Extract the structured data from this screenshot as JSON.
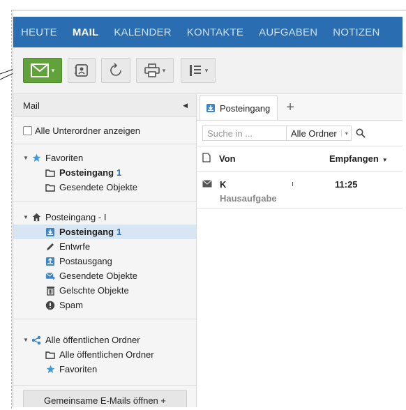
{
  "nav": {
    "items": [
      {
        "label": "HEUTE",
        "active": false
      },
      {
        "label": "MAIL",
        "active": true
      },
      {
        "label": "KALENDER",
        "active": false
      },
      {
        "label": "KONTAKTE",
        "active": false
      },
      {
        "label": "AUFGABEN",
        "active": false
      },
      {
        "label": "NOTIZEN",
        "active": false
      }
    ]
  },
  "toolbar": {
    "icons": [
      "envelope-icon",
      "address-book-icon",
      "refresh-icon",
      "printer-icon",
      "view-layout-icon"
    ],
    "accent": "#61a33a"
  },
  "sidebar": {
    "title": "Mail",
    "show_subfolders": "Alle Unterordner anzeigen",
    "favorites": {
      "label": "Favoriten",
      "items": [
        {
          "label": "Posteingang",
          "count": "1"
        },
        {
          "label": "Gesendete Objekte"
        }
      ]
    },
    "mailbox": {
      "label": "Posteingang - I",
      "items": [
        {
          "label": "Posteingang",
          "count": "1"
        },
        {
          "label": "Entwrfe"
        },
        {
          "label": "Postausgang"
        },
        {
          "label": "Gesendete Objekte"
        },
        {
          "label": "Gelschte Objekte"
        },
        {
          "label": "Spam"
        }
      ]
    },
    "public": {
      "label": "Alle öffentlichen Ordner",
      "items": [
        {
          "label": "Alle öffentlichen Ordner"
        },
        {
          "label": "Favoriten"
        }
      ]
    },
    "shared_button": "Gemeinsame E-Mails öffnen +"
  },
  "main": {
    "tab_label": "Posteingang",
    "tab_add": "+",
    "search_placeholder": "Suche in ...",
    "folder_select": "Alle Ordner",
    "col_from": "Von",
    "col_received": "Empfangen",
    "messages": [
      {
        "sender": "K",
        "separator": "ı",
        "time": "11:25",
        "subject": "Hausaufgabe"
      }
    ]
  },
  "colors": {
    "nav_bg": "#2a6db1",
    "selected_row": "#d8e6f3",
    "count": "#2a6db1"
  }
}
